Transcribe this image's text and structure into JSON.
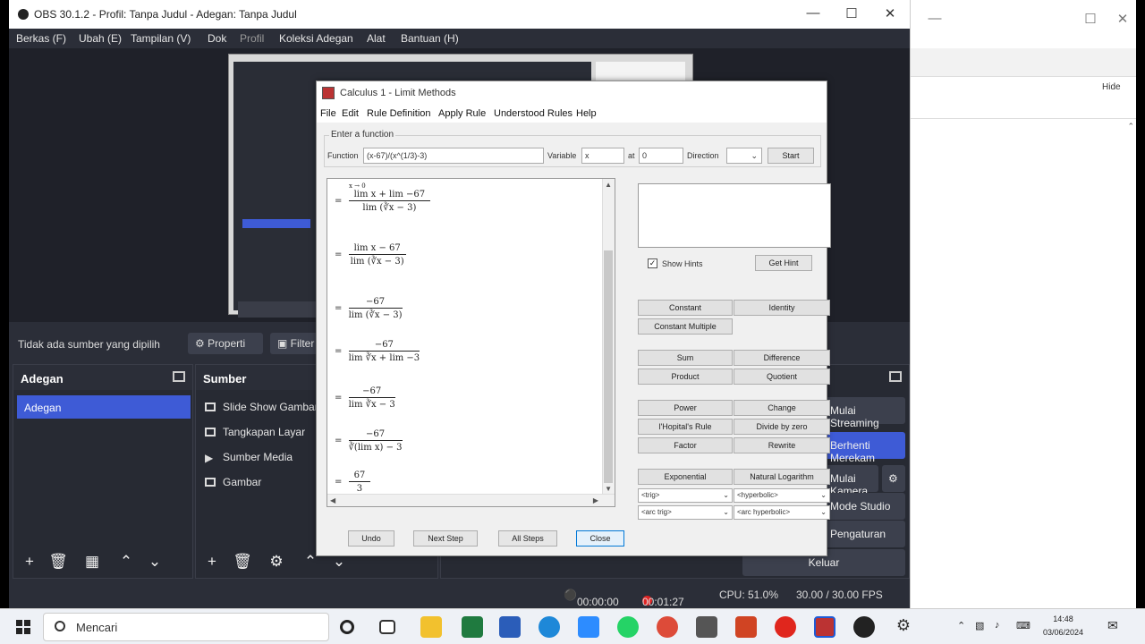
{
  "obs": {
    "title": "OBS 30.1.2 - Profil: Tanpa Judul - Adegan: Tanpa Judul",
    "menu": [
      "Berkas (F)",
      "Ubah (E)",
      "Tampilan (V)",
      "Dok",
      "Profil",
      "Koleksi Adegan",
      "Alat",
      "Bantuan (H)"
    ],
    "no_source": "Tidak ada sumber yang dipilih",
    "properties": "Properti",
    "filters": "Filter",
    "scenes_title": "Adegan",
    "scenes": [
      "Adegan"
    ],
    "sources_title": "Sumber",
    "sources": [
      "Slide Show Gambar",
      "Tangkapan Layar",
      "Sumber Media",
      "Gambar"
    ],
    "controls": [
      "Mulai Streaming",
      "Berhenti Merekam",
      "Mulai Kamera Virtual",
      "Mode Studio",
      "Pengaturan",
      "Keluar"
    ],
    "status": {
      "stream_time": "00:00:00",
      "rec_time": "00:01:27",
      "cpu": "CPU: 51.0%",
      "fps": "30.00 / 30.00 FPS"
    }
  },
  "rightwin": {
    "hide": "Hide"
  },
  "dialog": {
    "title": "Calculus 1 - Limit Methods",
    "menu": [
      "File",
      "Edit",
      "Rule Definition",
      "Apply Rule",
      "Understood Rules",
      "Help"
    ],
    "group": "Enter a function",
    "function_label": "Function",
    "function_value": "(x-67)/(x^(1/3)-3)",
    "variable_label": "Variable",
    "variable_value": "x",
    "at_label": "at",
    "at_value": "0",
    "direction_label": "Direction",
    "start": "Start",
    "show_hints": "Show Hints",
    "get_hint": "Get Hint",
    "rules": [
      "Constant",
      "Identity",
      "Constant Multiple",
      "Sum",
      "Difference",
      "Product",
      "Quotient",
      "Power",
      "Change",
      "l'Hopital's Rule",
      "Divide by zero",
      "Factor",
      "Rewrite",
      "Exponential",
      "Natural Logarithm"
    ],
    "selects": [
      "<trig>",
      "<hyperbolic>",
      "<arc trig>",
      "<arc hyperbolic>"
    ],
    "bottom": [
      "Undo",
      "Next Step",
      "All Steps",
      "Close"
    ],
    "final": {
      "num": "67",
      "den": "3"
    }
  },
  "taskbar": {
    "search": "Mencari",
    "time": "14:48",
    "date": "03/06/2024"
  }
}
